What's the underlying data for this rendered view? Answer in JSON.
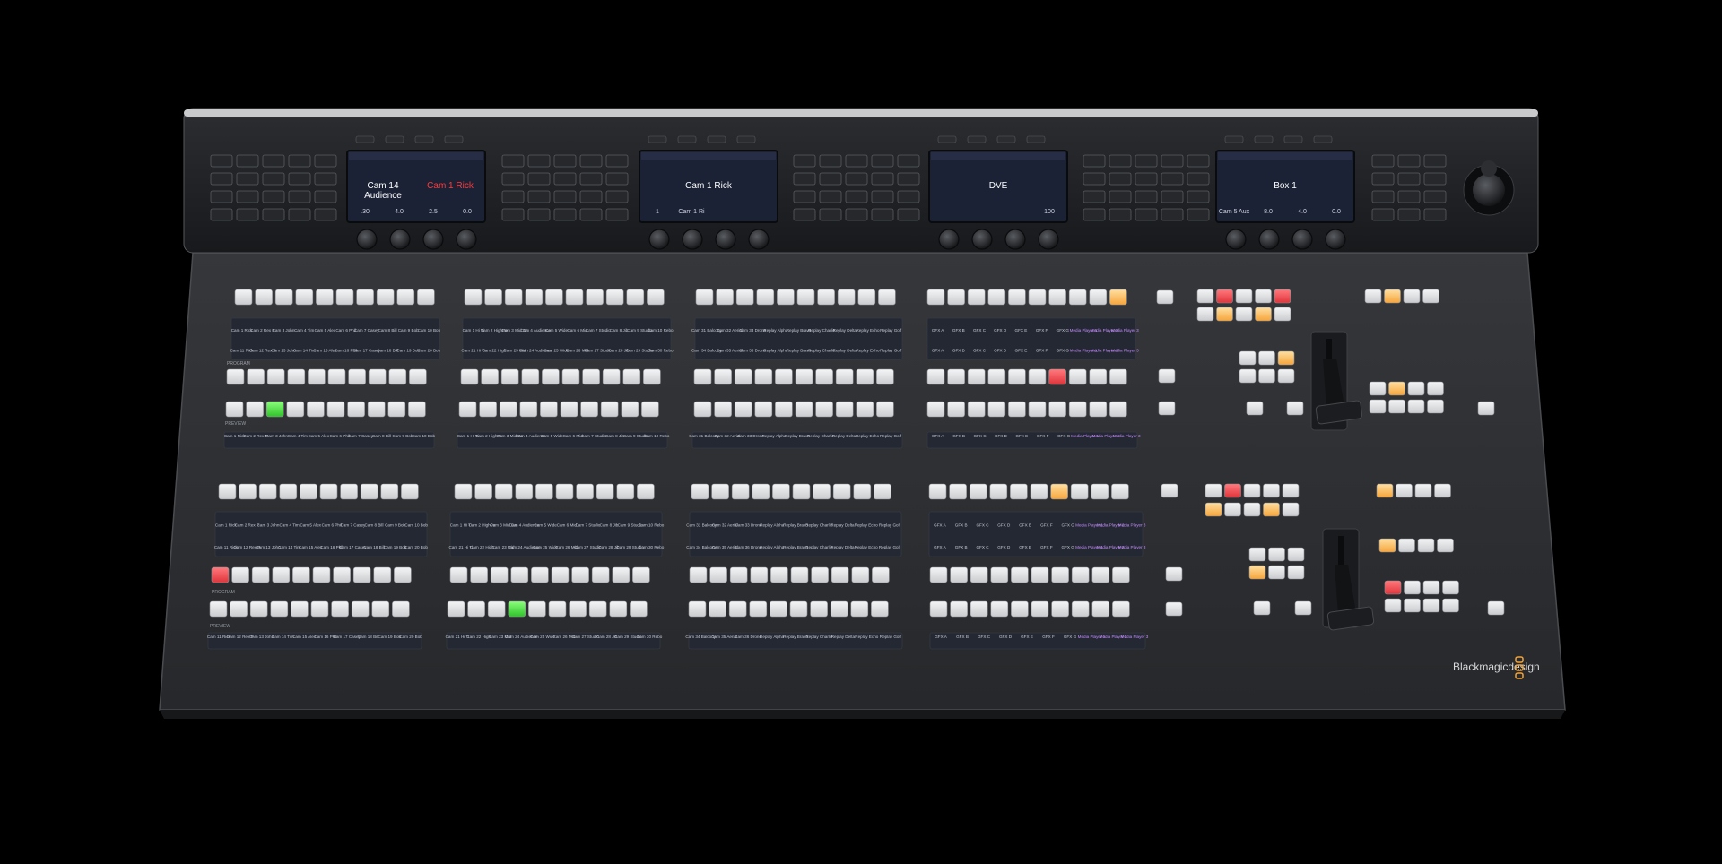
{
  "brand": {
    "name": "Blackmagicdesign",
    "logo_color": "#f2a33a"
  },
  "colors": {
    "background": "#000000",
    "panel": "#2e3034",
    "meter_bridge": "#1e2024",
    "key": "#e4e5e7",
    "led_red": "#f0464c",
    "led_green": "#46e040",
    "led_amber": "#ffb347",
    "lcd": "#1c2236",
    "label_strip": "#242832"
  },
  "lcds": [
    {
      "title": "",
      "primary": "Cam 14",
      "secondary": "Audience",
      "highlight": "Cam 1 Rick",
      "values": [
        ".30",
        "4.0",
        "2.5",
        "0.0"
      ]
    },
    {
      "title": "",
      "primary": "Cam 1 Rick",
      "secondary": "",
      "highlight": "",
      "values": [
        "1",
        "Cam 1 Ri",
        "",
        ""
      ]
    },
    {
      "title": "",
      "primary": "DVE",
      "secondary": "",
      "highlight": "",
      "values": [
        "",
        "",
        "",
        "100"
      ]
    },
    {
      "title": "",
      "primary": "Box 1",
      "secondary": "",
      "highlight": "",
      "values": [
        "Cam 5 Aux",
        "8.0",
        "4.0",
        "0.0"
      ]
    }
  ],
  "source_labels": {
    "bank_a_top": [
      "Cam 1 Rick",
      "Cam 2 Rex P",
      "Cam 3 John",
      "Cam 4 Tim",
      "Cam 5 Alex",
      "Cam 6 Phil",
      "Cam 7 Casey",
      "Cam 8 Bill",
      "Cam 9 Bob",
      "Cam 10 Bob"
    ],
    "bank_a_bottom": [
      "Cam 11 Rick",
      "Cam 12 Rex P",
      "Cam 13 John",
      "Cam 14 Tim",
      "Cam 15 Alex",
      "Cam 16 Phil",
      "Cam 17 Casey",
      "Cam 18 Bill",
      "Cam 19 Bob",
      "Cam 20 Bob"
    ],
    "bank_b_top": [
      "Cam 1 Hi Ti",
      "Cam 2 HighPe",
      "Cam 3 Mid Ca",
      "Cam 4 Audience",
      "Cam 5 Wide",
      "Cam 6 Mid",
      "Cam 7 Studio",
      "Cam 8 Jib",
      "Cam 9 Studio",
      "Cam 10 Rebo"
    ],
    "bank_b_bottom": [
      "Cam 21 Hi Ti",
      "Cam 22 High",
      "Cam 23 Mid",
      "Cam 24 Audience",
      "Cam 25 Wide",
      "Cam 26 Mid",
      "Cam 27 Studio",
      "Cam 28 Jib",
      "Cam 29 Studio",
      "Cam 30 Rebo"
    ],
    "bank_c_top": [
      "Cam 31 Balcony",
      "Cam 32 Aerial",
      "Cam 33 Drone",
      "Replay Alpha",
      "Replay Bravo",
      "Replay Charlie",
      "Replay Delta",
      "Replay Echo",
      "Replay Golf"
    ],
    "bank_c_bottom": [
      "Cam 34 Balcony",
      "Cam 35 Aerial",
      "Cam 36 Drone",
      "Replay Alpha",
      "Replay Bravo",
      "Replay Charlie",
      "Replay Delta",
      "Replay Echo",
      "Replay Golf"
    ],
    "bank_d_top": [
      "GFX A",
      "GFX B",
      "GFX C",
      "GFX D",
      "GFX E",
      "GFX F",
      "GFX G",
      "Media Player 1",
      "Media Player 2",
      "Media Player 3"
    ],
    "bank_d_bottom": [
      "GFX A",
      "GFX B",
      "GFX C",
      "GFX D",
      "GFX E",
      "GFX F",
      "GFX G",
      "Media Player 1",
      "Media Player 2",
      "Media Player 3"
    ]
  },
  "key_labels": {
    "row_label_program_1": "PROGRAM",
    "row_label_preview_1": "PREVIEW",
    "row_label_program_2": "PROGRAM",
    "row_label_preview_2": "PREVIEW"
  }
}
